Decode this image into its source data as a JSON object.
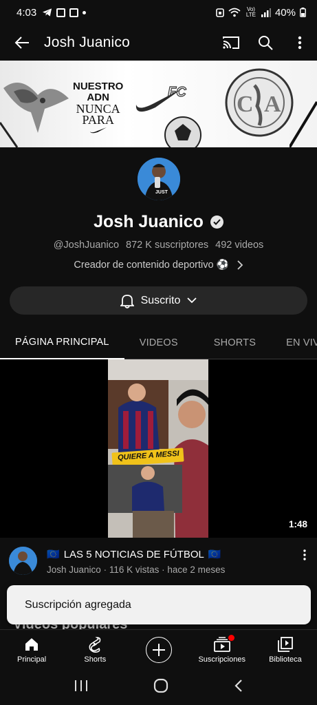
{
  "status_bar": {
    "time": "4:03",
    "battery": "40%",
    "network": "Vo) LTE"
  },
  "app_bar": {
    "title": "Josh Juanico"
  },
  "banner": {
    "line1": "NUESTRO",
    "line2": "ADN",
    "line3": "NUNCA",
    "line4": "PARA",
    "brand": "FC"
  },
  "channel": {
    "name": "Josh Juanico",
    "handle": "@JoshJuanico",
    "subscribers": "872 K suscriptores",
    "videos": "492 videos",
    "description": "Creador de contenido deportivo ⚽"
  },
  "subscribe_button": {
    "label": "Suscrito"
  },
  "tabs": [
    {
      "label": "PÁGINA PRINCIPAL",
      "active": true
    },
    {
      "label": "VIDEOS",
      "active": false
    },
    {
      "label": "SHORTS",
      "active": false
    },
    {
      "label": "EN VIVO",
      "active": false
    }
  ],
  "featured_video": {
    "thumbnail_caption": "QUIERE A MESSI",
    "duration": "1:48",
    "title": "LAS 5 NOTICIAS DE FÚTBOL",
    "flag_left": "🇪🇺",
    "flag_right": "🇪🇺",
    "channel": "Josh Juanico",
    "views": "116 K vistas",
    "age": "hace 2 meses"
  },
  "section_peek": {
    "title": "Videos populares"
  },
  "toast": {
    "message": "Suscripción agregada"
  },
  "bottom_nav": [
    {
      "label": "Principal",
      "icon": "home-icon"
    },
    {
      "label": "Shorts",
      "icon": "shorts-icon"
    },
    {
      "label": "",
      "icon": "create-icon"
    },
    {
      "label": "Suscripciones",
      "icon": "subscriptions-icon",
      "badge": true
    },
    {
      "label": "Biblioteca",
      "icon": "library-icon"
    }
  ],
  "colors": {
    "background": "#0f0f0f",
    "chip": "#272727",
    "secondary_text": "#aaaaaa",
    "notification_dot": "#ff0000",
    "toast_bg": "#f1f1f1"
  }
}
